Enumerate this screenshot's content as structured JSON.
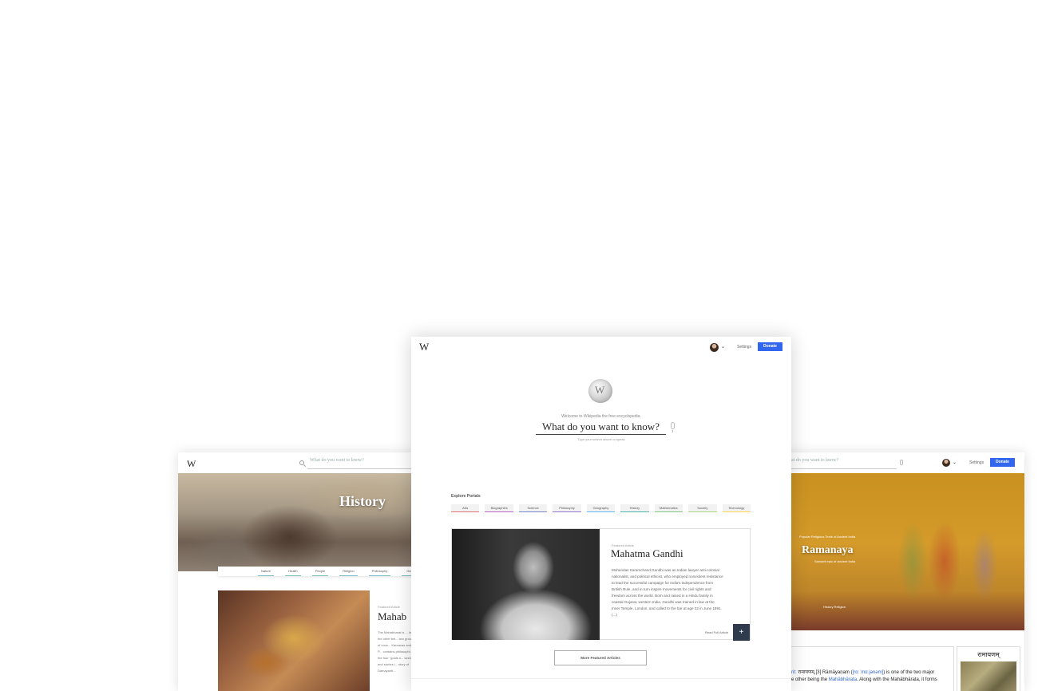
{
  "left_window": {
    "logo": "W",
    "search_placeholder": "What do you want to know?",
    "hero_title": "History",
    "tabs": [
      "Nature",
      "Health",
      "People",
      "Religion",
      "Philosophy",
      "Geo"
    ],
    "featured_label": "Featured Article",
    "featured_title": "Mahab",
    "featured_text": "The Mahabharat is ... India, the other bei... two groups of cous... Kauravas and the P... contains philosophi... of the four \"goals o... works and stories i... story of Damayanti..."
  },
  "right_window": {
    "search_placeholder": "at do you want to know?",
    "settings_label": "Settings",
    "donate_label": "Donate",
    "hero_kicker": "Popular Religious Texts of Ancient India",
    "hero_title": "Ramanaya",
    "hero_sub": "Sanskrit epic of ancient India",
    "hero_tags": "History   Religion",
    "body_line_1_prefix": "rit: ",
    "body_line_1_text": "रामायणम्,[3] Rāmāyaṇam",
    "body_line_1_ipa": "[rɑːˈmɑːjənəm]",
    "body_line_1_suffix": ") is one of the two major",
    "body_line_2_prefix": "e other being the ",
    "body_line_2_link": "Mahābhārata",
    "body_line_2_suffix": ". Along with the Mahābhārata,  it forms",
    "infobox_title": "रामायणम्"
  },
  "center_window": {
    "logo": "W",
    "settings_label": "Settings",
    "donate_label": "Donate",
    "welcome": "Welcome to Wikipedia the free encyclopedia.",
    "search_prompt": "What do you want to know?",
    "search_hint": "Type your search above or speak",
    "portals_heading": "Explore Portals",
    "portals": [
      {
        "label": "Arts",
        "color": "#e57373"
      },
      {
        "label": "Biographies",
        "color": "#ba68c8"
      },
      {
        "label": "Science",
        "color": "#7986cb"
      },
      {
        "label": "Philosophy",
        "color": "#9575cd"
      },
      {
        "label": "Geography",
        "color": "#64b5f6"
      },
      {
        "label": "History",
        "color": "#4db6ac"
      },
      {
        "label": "Mathematics",
        "color": "#81c784"
      },
      {
        "label": "Society",
        "color": "#aed581"
      },
      {
        "label": "Technology",
        "color": "#ffd54f"
      }
    ],
    "featured_label": "Featured Article",
    "featured_title": "Mahatma Gandhi",
    "featured_text": "Mohandas Karamchand Gandhi was an Indian lawyer anti-colonial nationalist, and political ethicist, who employed nonviolent resistance to lead the successful campaign for India's independence from British Rule, and in turn inspire movements for civil rights and freedom across the world. Born and raised in a Hindu family in coastal Gujarat, western India, Gandhi was trained in law at the Inner Temple, London, and called to the bar at age 22 in June 1891.(...)",
    "read_full_label": "Read Full Article",
    "plus_label": "+",
    "more_label": "More Featured Articles"
  }
}
